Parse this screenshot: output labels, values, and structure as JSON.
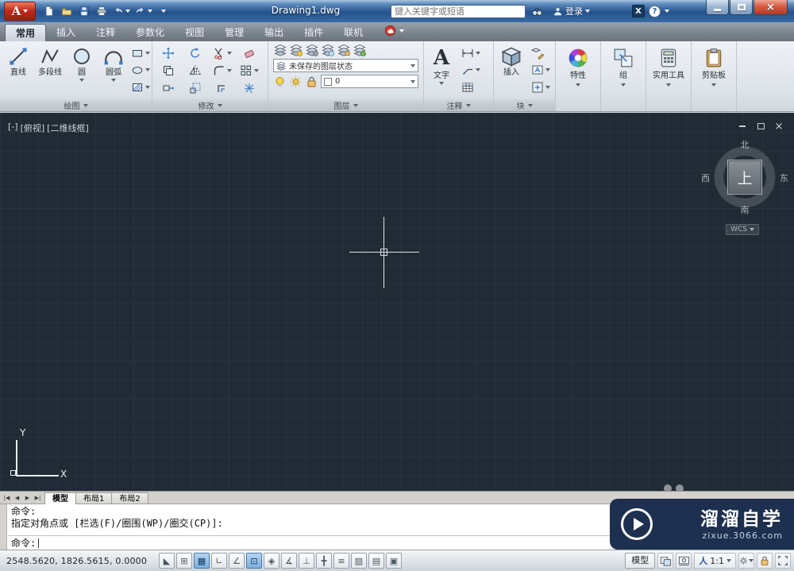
{
  "titlebar": {
    "app_letter": "A",
    "quick_access": [
      {
        "id": "new-file",
        "icon": "newfile"
      },
      {
        "id": "open-file",
        "icon": "openfolder"
      },
      {
        "id": "save",
        "icon": "save"
      },
      {
        "id": "plot",
        "icon": "printer"
      },
      {
        "id": "undo",
        "icon": "undo",
        "caret": true
      },
      {
        "id": "redo",
        "icon": "redo",
        "caret": true
      },
      {
        "id": "customize-quick-access",
        "caret": true
      }
    ],
    "title": "Drawing1.dwg",
    "search_placeholder": "键入关键字或短语",
    "login_label": "登录",
    "exchange_label": "X",
    "help_label": "?"
  },
  "ribbon": {
    "tabs": [
      {
        "id": "home",
        "label": "常用",
        "active": true
      },
      {
        "id": "insert",
        "label": "插入"
      },
      {
        "id": "annotate",
        "label": "注释"
      },
      {
        "id": "parametric",
        "label": "参数化"
      },
      {
        "id": "view",
        "label": "视图"
      },
      {
        "id": "manage",
        "label": "管理"
      },
      {
        "id": "output",
        "label": "输出"
      },
      {
        "id": "plugins",
        "label": "插件"
      },
      {
        "id": "online",
        "label": "联机"
      }
    ],
    "panels": {
      "draw": {
        "label": "绘图",
        "large_buttons": [
          {
            "id": "line",
            "label": "直线",
            "icon": "line"
          },
          {
            "id": "polyline",
            "label": "多段线",
            "icon": "polyline"
          },
          {
            "id": "circle",
            "label": "圆",
            "icon": "circle",
            "caret": true
          },
          {
            "id": "arc",
            "label": "圆弧",
            "icon": "arc",
            "caret": true
          }
        ],
        "small_buttons": [
          {
            "id": "rectangle",
            "icon": "recttool",
            "caret": true
          },
          {
            "id": "ellipse",
            "icon": "ellipsetool",
            "caret": true
          },
          {
            "id": "hatch",
            "icon": "hatch",
            "caret": true
          }
        ]
      },
      "modify": {
        "label": "修改",
        "buttons": [
          {
            "id": "move",
            "icon": "move"
          },
          {
            "id": "rotate",
            "icon": "rotate"
          },
          {
            "id": "trim",
            "icon": "trim",
            "caret": true
          },
          {
            "id": "erase",
            "icon": "erase"
          },
          {
            "id": "copy",
            "icon": "copy"
          },
          {
            "id": "mirror",
            "icon": "mirror"
          },
          {
            "id": "fillet",
            "icon": "fillet",
            "caret": true
          },
          {
            "id": "array",
            "icon": "array",
            "caret": true
          },
          {
            "id": "stretch",
            "icon": "stretch"
          },
          {
            "id": "scale",
            "icon": "scale"
          },
          {
            "id": "offset",
            "icon": "offset"
          },
          {
            "id": "explode",
            "icon": "explode"
          }
        ]
      },
      "layers": {
        "label": "图层",
        "tool_buttons": [
          {
            "id": "layer-properties",
            "icon": "layerprops"
          },
          {
            "id": "layer-off",
            "icon": "layeroff"
          },
          {
            "id": "layer-isolate",
            "icon": "layeriso"
          },
          {
            "id": "layer-freeze",
            "icon": "layerfreeze"
          },
          {
            "id": "layer-lock",
            "icon": "layerlock"
          },
          {
            "id": "layer-match",
            "icon": "layermatch"
          }
        ],
        "layer_state": "未保存的图层状态",
        "current_layer": "0"
      },
      "annotation": {
        "label": "注释",
        "text_button": {
          "glyph": "A",
          "label": "文字"
        },
        "small_buttons": [
          {
            "id": "dimension",
            "icon": "dim",
            "caret": true
          },
          {
            "id": "multileader",
            "icon": "leader",
            "caret": true
          },
          {
            "id": "table",
            "icon": "tableic"
          }
        ]
      },
      "block": {
        "label": "块",
        "insert_button": {
          "label": "插入",
          "icon": "insertblock"
        },
        "small_buttons": [
          {
            "id": "edit-block",
            "icon": "editblock"
          },
          {
            "id": "define-attributes",
            "icon": "attrib",
            "caret": true
          },
          {
            "id": "block-editor",
            "icon": "blocked",
            "caret": true
          }
        ]
      },
      "collapsed": [
        {
          "id": "properties",
          "label": "特性",
          "icon": "colorwheel"
        },
        {
          "id": "groups",
          "label": "组",
          "icon": "groupic"
        },
        {
          "id": "utilities",
          "label": "实用工具",
          "icon": "calculator"
        },
        {
          "id": "clipboard",
          "label": "剪贴板",
          "icon": "clipboardic"
        }
      ]
    }
  },
  "viewport": {
    "controls": [
      "[-]",
      "[俯视]",
      "[二维线框]"
    ],
    "viewcube": {
      "north": "北",
      "south": "南",
      "west": "西",
      "east": "东",
      "top": "上"
    },
    "wcs_label": "WCS",
    "ucs": {
      "x": "X",
      "y": "Y"
    }
  },
  "layout_bar": {
    "tabs": [
      {
        "id": "model",
        "label": "模型",
        "active": true
      },
      {
        "id": "layout1",
        "label": "布局1"
      },
      {
        "id": "layout2",
        "label": "布局2"
      }
    ]
  },
  "command_line": {
    "history": [
      "命令:",
      "指定对角点或 [栏选(F)/圈围(WP)/圈交(CP)]:"
    ],
    "prompt": "命令:"
  },
  "status_bar": {
    "coordinates": "2548.5620, 1826.5615, 0.0000",
    "toggles": [
      {
        "id": "infer-constraints",
        "glyph": "◣"
      },
      {
        "id": "snap-mode",
        "glyph": "⊞"
      },
      {
        "id": "grid-display",
        "glyph": "▦",
        "active": true
      },
      {
        "id": "ortho-mode",
        "glyph": "∟"
      },
      {
        "id": "polar-tracking",
        "glyph": "∠"
      },
      {
        "id": "object-snap",
        "glyph": "⊡",
        "active": true
      },
      {
        "id": "3d-object-snap",
        "glyph": "◈"
      },
      {
        "id": "object-snap-tracking",
        "glyph": "∡"
      },
      {
        "id": "dynamic-ucs",
        "glyph": "⊥"
      },
      {
        "id": "dynamic-input",
        "glyph": "╋"
      },
      {
        "id": "lineweight",
        "glyph": "≡"
      },
      {
        "id": "transparency",
        "glyph": "▨"
      },
      {
        "id": "quick-properties",
        "glyph": "▤"
      },
      {
        "id": "selection-cycling",
        "glyph": "▣"
      }
    ],
    "model_label": "模型",
    "annotation_person": "人",
    "annotation_scale": "1:1"
  },
  "watermark": {
    "title": "溜溜自学",
    "url": "zixue.3066.com"
  },
  "colors": {
    "titlebar_blue": "#2f5f9b",
    "ribbon_bg": "#e3e8ee",
    "canvas_bg": "#212b35",
    "watermark_bg": "#152849",
    "active_toggle": "#7aaede",
    "close_red": "#d85a43"
  }
}
